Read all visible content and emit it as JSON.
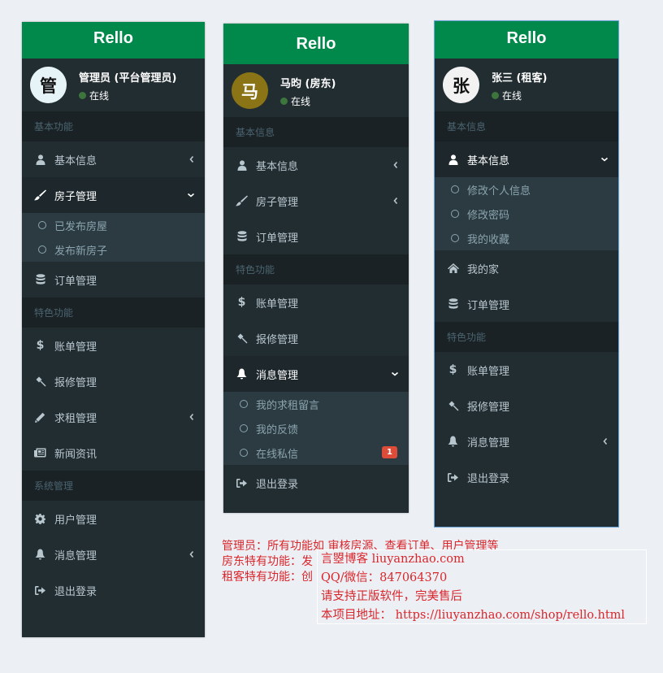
{
  "brand": "Rello",
  "status_online": "在线",
  "panels": {
    "admin": {
      "avatar_char": "管",
      "user_name": "管理员 (平台管理员)",
      "sections": [
        {
          "header": "基本功能",
          "items": [
            {
              "label": "基本信息",
              "icon": "user-icon"
            },
            {
              "label": "房子管理",
              "icon": "paint-brush-icon",
              "sub": [
                "已发布房屋",
                "发布新房子"
              ]
            },
            {
              "label": "订单管理",
              "icon": "database-icon"
            }
          ]
        },
        {
          "header": "特色功能",
          "items": [
            {
              "label": "账单管理",
              "icon": "dollar-icon"
            },
            {
              "label": "报修管理",
              "icon": "gavel-icon"
            },
            {
              "label": "求租管理",
              "icon": "pencil-icon"
            },
            {
              "label": "新闻资讯",
              "icon": "newspaper-icon"
            }
          ]
        },
        {
          "header": "系统管理",
          "items": [
            {
              "label": "用户管理",
              "icon": "gear-icon"
            },
            {
              "label": "消息管理",
              "icon": "bell-icon"
            },
            {
              "label": "退出登录",
              "icon": "sign-out-icon"
            }
          ]
        }
      ]
    },
    "landlord": {
      "avatar_char": "马",
      "user_name": "马昀 (房东)",
      "sections": [
        {
          "header": "基本信息",
          "items": [
            {
              "label": "基本信息",
              "icon": "user-icon"
            },
            {
              "label": "房子管理",
              "icon": "paint-brush-icon"
            },
            {
              "label": "订单管理",
              "icon": "database-icon"
            }
          ]
        },
        {
          "header": "特色功能",
          "items": [
            {
              "label": "账单管理",
              "icon": "dollar-icon"
            },
            {
              "label": "报修管理",
              "icon": "gavel-icon"
            },
            {
              "label": "消息管理",
              "icon": "bell-icon",
              "sub": [
                "我的求租留言",
                "我的反馈",
                "在线私信"
              ],
              "badge": "1"
            },
            {
              "label": "退出登录",
              "icon": "sign-out-icon"
            }
          ]
        }
      ]
    },
    "tenant": {
      "avatar_char": "张",
      "user_name": "张三 (租客)",
      "sections": [
        {
          "header": "基本信息",
          "items": [
            {
              "label": "基本信息",
              "icon": "user-icon",
              "sub": [
                "修改个人信息",
                "修改密码",
                "我的收藏"
              ]
            },
            {
              "label": "我的家",
              "icon": "home-icon"
            },
            {
              "label": "订单管理",
              "icon": "database-icon"
            }
          ]
        },
        {
          "header": "特色功能",
          "items": [
            {
              "label": "账单管理",
              "icon": "dollar-icon"
            },
            {
              "label": "报修管理",
              "icon": "gavel-icon"
            },
            {
              "label": "消息管理",
              "icon": "bell-icon"
            },
            {
              "label": "退出登录",
              "icon": "sign-out-icon"
            }
          ]
        }
      ]
    }
  },
  "caption": [
    "管理员：所有功能如 审核房源、查看订单、用户管理等",
    "房东特有功能：发",
    "租客特有功能：创"
  ],
  "watermark": [
    "言曌博客 liuyanzhao.com",
    "QQ/微信：847064370",
    "请支持正版软件，完美售后",
    "本项目地址： https://liuyanzhao.com/shop/rello.html"
  ],
  "colors": {
    "brand": "#00894a",
    "sidebar_bg": "#222d32",
    "header_bg": "#1a2226",
    "active_bg": "#1e282c",
    "submenu_bg": "#2c3b41",
    "online": "#3c763d",
    "badge": "#dd4b39",
    "note_text": "#d9262b"
  }
}
